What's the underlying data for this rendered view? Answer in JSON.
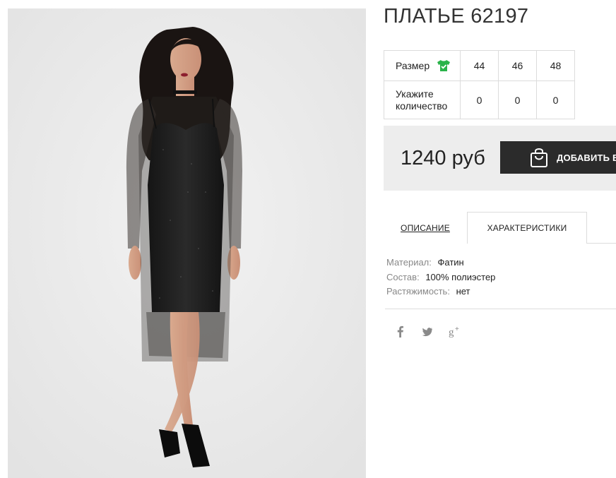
{
  "product": {
    "title": "ПЛАТЬЕ 62197"
  },
  "sizes": {
    "header_label": "Размер",
    "header_icon": "tshirt-check-icon",
    "icon_color": "#2bb34a",
    "values": [
      "44",
      "46",
      "48"
    ],
    "qty_label": "Укажите количество",
    "quantities": [
      "0",
      "0",
      "0"
    ]
  },
  "purchase": {
    "price": "1240 руб",
    "add_button_label": "ДОБАВИТЬ В",
    "bag_icon": "shopping-bag-icon"
  },
  "tabs": [
    {
      "label": "ОПИСАНИЕ",
      "active": false
    },
    {
      "label": "ХАРАКТЕРИСТИКИ",
      "active": true
    }
  ],
  "specs": [
    {
      "key": "Материал:",
      "value": "Фатин"
    },
    {
      "key": "Состав:",
      "value": "100% полиэстер"
    },
    {
      "key": "Растяжимость:",
      "value": "нет"
    }
  ],
  "social": [
    "facebook-icon",
    "twitter-icon",
    "google-plus-icon"
  ],
  "colors": {
    "button_bg": "#2b2b2b",
    "buybar_bg": "#ededed",
    "photo_bg": "#ececec"
  }
}
